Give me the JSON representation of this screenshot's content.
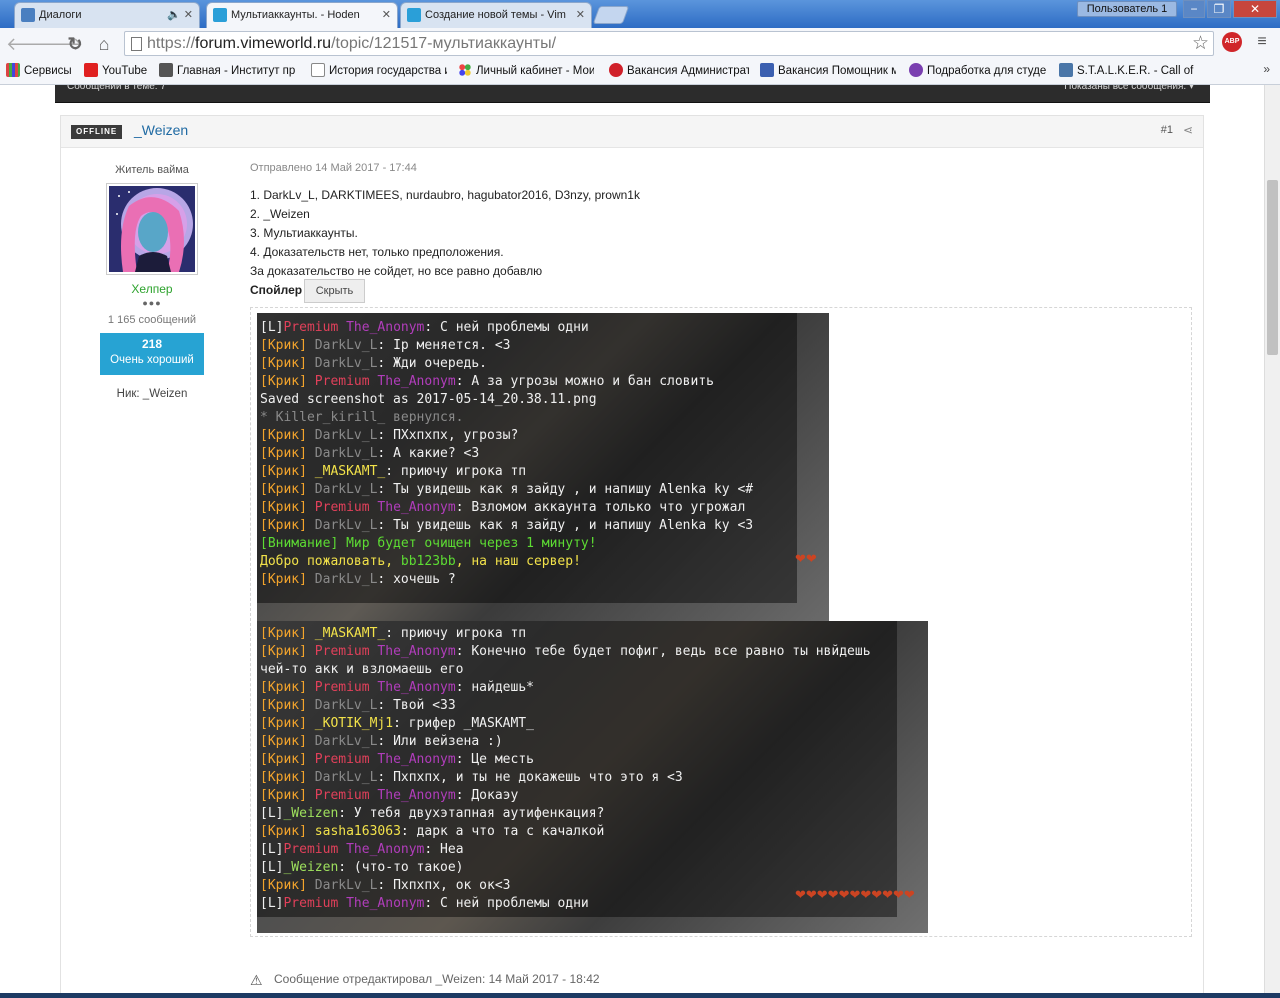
{
  "browser": {
    "tabs": [
      {
        "title": "Диалоги",
        "favicon_color": "#4a7fc0",
        "active": false
      },
      {
        "title": "Мультиаккаунты. - Hoden",
        "favicon_color": "#2a9fd8",
        "active": true
      },
      {
        "title": "Создание новой темы - Vim",
        "favicon_color": "#2a9fd8",
        "active": false
      }
    ],
    "user_label": "Пользователь 1",
    "window_buttons": [
      "−",
      "❐",
      "✕"
    ],
    "url": {
      "scheme": "https://",
      "host": "forum.vimeworld.ru",
      "path": "/topic/121517-мультиаккаунты/"
    },
    "abp_label": "ABP",
    "bookmarks": [
      {
        "label": "Сервисы",
        "icon": "apps-grid-icon",
        "color": "#d44"
      },
      {
        "label": "YouTube",
        "icon": "youtube-icon",
        "color": "#e02020"
      },
      {
        "label": "Главная - Институт пр",
        "icon": "scales-icon",
        "color": "#555"
      },
      {
        "label": "История государства и",
        "icon": "page-icon",
        "color": "#888"
      },
      {
        "label": "Личный кабинет - Мои",
        "icon": "dots-icon",
        "color": "#4aa"
      },
      {
        "label": "Вакансия Администрат",
        "icon": "hh-icon",
        "color": "#d0202a"
      },
      {
        "label": "Вакансия Помощник ме",
        "icon": "doc-icon",
        "color": "#3b5fb0"
      },
      {
        "label": "Подработка для студе",
        "icon": "q-icon",
        "color": "#7a3fb0"
      },
      {
        "label": "S.T.A.L.K.E.R. - Call of",
        "icon": "vk-icon",
        "color": "#4a76a8"
      }
    ],
    "bookmarks_more": "»"
  },
  "forum": {
    "top_strip_left": "Сообщений в теме: 7",
    "top_strip_right": "Показаны все сообщения. ▾",
    "post": {
      "status": "OFFLINE",
      "author": "_Weizen",
      "post_number": "#1",
      "rank_title": "Житель вайма",
      "group": "Хелпер",
      "pips": "●●●",
      "post_count": "1 165 сообщений",
      "reputation": "218",
      "reputation_label": "Очень хороший",
      "nick": "Ник: _Weizen",
      "date": "Отправлено 14 Май 2017 - 17:44",
      "body_lines": [
        "1. DarkLv_L, DARKTIMEES, nurdaubro, hagubator2016, D3nzy, prown1k",
        "2. _Weizen",
        "3. Мультиаккаунты.",
        "4. Доказательств нет, только предположения.",
        "За доказательство не сойдет, но все равно добавлю"
      ],
      "spoiler_label": "Спойлер",
      "spoiler_button": "Скрыть",
      "edit_note": "Сообщение отредактировал _Weizen: 14 Май 2017 - 18:42"
    }
  },
  "screenshot1_lines": [
    [
      [
        "[L]",
        "wh"
      ],
      [
        "Premium ",
        "red"
      ],
      [
        "The_Anonym",
        "pink"
      ],
      [
        ": С ней проблемы одни",
        "wh"
      ]
    ],
    [
      [
        "[Крик] ",
        "or"
      ],
      [
        "DarkLv_L",
        "gray"
      ],
      [
        ": Ip меняется. <3",
        "wh"
      ]
    ],
    [
      [
        "[Крик] ",
        "or"
      ],
      [
        "DarkLv_L",
        "gray"
      ],
      [
        ": Жди очередь.",
        "wh"
      ]
    ],
    [
      [
        "[Крик] ",
        "or"
      ],
      [
        "Premium ",
        "red"
      ],
      [
        "The_Anonym",
        "pink"
      ],
      [
        ": А за угрозы можно и бан словить",
        "wh"
      ]
    ],
    [
      [
        "Saved screenshot as 2017-05-14_20.38.11.png",
        "wh"
      ]
    ],
    [
      [
        "* Killer_kirill_  вернулся.",
        "gray"
      ]
    ],
    [
      [
        "[Крик] ",
        "or"
      ],
      [
        "DarkLv_L",
        "gray"
      ],
      [
        ": ПХхпхпх, угрозы?",
        "wh"
      ]
    ],
    [
      [
        "[Крик] ",
        "or"
      ],
      [
        "DarkLv_L",
        "gray"
      ],
      [
        ": А какие? <3",
        "wh"
      ]
    ],
    [
      [
        "[Крик] ",
        "or"
      ],
      [
        "_MASKAMT_",
        "yel"
      ],
      [
        ": приючу игрока тп",
        "wh"
      ]
    ],
    [
      [
        "[Крик] ",
        "or"
      ],
      [
        "DarkLv_L",
        "gray"
      ],
      [
        ": Ты увидешь как я зайду , и напишу Alenka ky <#",
        "wh"
      ]
    ],
    [
      [
        "[Крик] ",
        "or"
      ],
      [
        "Premium ",
        "red"
      ],
      [
        "The_Anonym",
        "pink"
      ],
      [
        ": Взломом аккаунта только что угрожал",
        "wh"
      ]
    ],
    [
      [
        "[Крик] ",
        "or"
      ],
      [
        "DarkLv_L",
        "gray"
      ],
      [
        ": Ты увидешь как я зайду , и напишу Alenka ky <3",
        "wh"
      ]
    ],
    [
      [
        "[Внимание] Мир будет очищен через 1 минуту!",
        "grn"
      ]
    ],
    [
      [
        "Добро пожаловать, ",
        "yel"
      ],
      [
        "bb123bb",
        "grn"
      ],
      [
        ", на наш сервер!",
        "yel"
      ]
    ],
    [
      [
        "[Крик] ",
        "or"
      ],
      [
        "DarkLv_L",
        "gray"
      ],
      [
        ": хочешь ?",
        "wh"
      ]
    ]
  ],
  "screenshot2_lines": [
    [
      [
        "[Крик] ",
        "or"
      ],
      [
        "_MASKAMT_",
        "yel"
      ],
      [
        ": приючу игрока тп",
        "wh"
      ]
    ],
    [
      [
        "[Крик] ",
        "or"
      ],
      [
        "Premium ",
        "red"
      ],
      [
        "The_Anonym",
        "pink"
      ],
      [
        ": Конечно тебе будет пофиг, ведь все равно ты нвйдешь",
        "wh"
      ]
    ],
    [
      [
        " чей-то акк и взломаешь его",
        "wh"
      ]
    ],
    [
      [
        "[Крик] ",
        "or"
      ],
      [
        "Premium ",
        "red"
      ],
      [
        "The_Anonym",
        "pink"
      ],
      [
        ": найдешь*",
        "wh"
      ]
    ],
    [
      [
        "[Крик] ",
        "or"
      ],
      [
        "DarkLv_L",
        "gray"
      ],
      [
        ": Твой <33",
        "wh"
      ]
    ],
    [
      [
        "[Крик] ",
        "or"
      ],
      [
        "_KOTIK_Mj1",
        "yel"
      ],
      [
        ":  грифер _MASKAMT_",
        "wh"
      ]
    ],
    [
      [
        "[Крик] ",
        "or"
      ],
      [
        "DarkLv_L",
        "gray"
      ],
      [
        ": Или вейзена :)",
        "wh"
      ]
    ],
    [
      [
        "[Крик] ",
        "or"
      ],
      [
        "Premium ",
        "red"
      ],
      [
        "The_Anonym",
        "pink"
      ],
      [
        ": Це месть",
        "wh"
      ]
    ],
    [
      [
        "[Крик] ",
        "or"
      ],
      [
        "DarkLv_L",
        "gray"
      ],
      [
        ": Пхпхпх, и ты не докажешь что это я <3",
        "wh"
      ]
    ],
    [
      [
        "[Крик] ",
        "or"
      ],
      [
        "Premium ",
        "red"
      ],
      [
        "The_Anonym",
        "pink"
      ],
      [
        ": Докаэу",
        "wh"
      ]
    ],
    [
      [
        "[L]",
        "wh"
      ],
      [
        "_Weizen",
        "lgrn"
      ],
      [
        ": У тебя двухэтапная аутифенкация?",
        "wh"
      ]
    ],
    [
      [
        "[Крик] ",
        "or"
      ],
      [
        "sasha163063",
        "yel"
      ],
      [
        ": дарк а что та с качалкой",
        "wh"
      ]
    ],
    [
      [
        "[L]",
        "wh"
      ],
      [
        "Premium ",
        "red"
      ],
      [
        "The_Anonym",
        "pink"
      ],
      [
        ": Неа",
        "wh"
      ]
    ],
    [
      [
        "[L]",
        "wh"
      ],
      [
        "_Weizen",
        "lgrn"
      ],
      [
        ": (что-то такое)",
        "wh"
      ]
    ],
    [
      [
        "[Крик] ",
        "or"
      ],
      [
        "DarkLv_L",
        "gray"
      ],
      [
        ": Пхпхпх, ок ок<3",
        "wh"
      ]
    ],
    [
      [
        "[L]",
        "wh"
      ],
      [
        "Premium ",
        "red"
      ],
      [
        "The_Anonym",
        "pink"
      ],
      [
        ": С ней проблемы одни",
        "wh"
      ]
    ]
  ]
}
